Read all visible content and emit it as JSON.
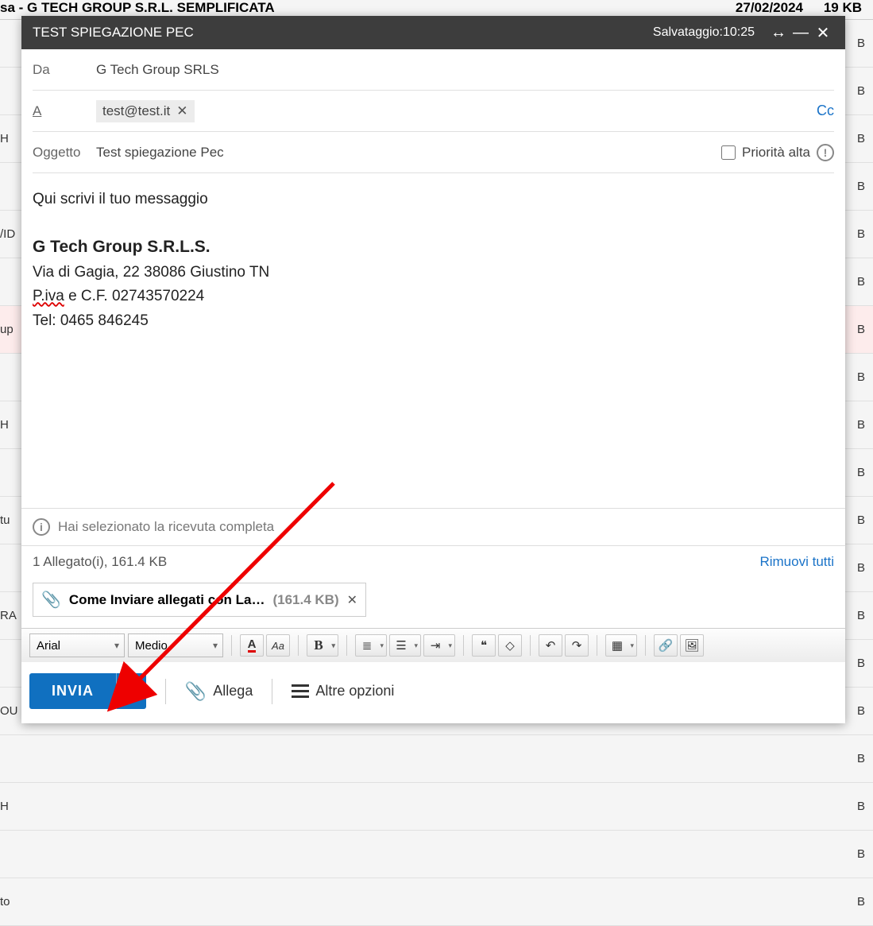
{
  "background": {
    "header_subject": "sa - G TECH GROUP S.R.L. SEMPLIFICATA",
    "header_date": "27/02/2024",
    "header_size": "19 KB",
    "rows": [
      {
        "left": ""
      },
      {
        "left": ""
      },
      {
        "left": "H"
      },
      {
        "left": ""
      },
      {
        "left": "/ID"
      },
      {
        "left": ""
      },
      {
        "left": "up",
        "pink": true
      },
      {
        "left": ""
      },
      {
        "left": "H"
      },
      {
        "left": ""
      },
      {
        "left": "tu"
      },
      {
        "left": ""
      },
      {
        "left": "RA"
      },
      {
        "left": ""
      },
      {
        "left": "OU"
      },
      {
        "left": ""
      },
      {
        "left": "H"
      },
      {
        "left": ""
      },
      {
        "left": "to"
      }
    ],
    "kb_suffix": "B"
  },
  "title": "TEST SPIEGAZIONE PEC",
  "save_label": "Salvataggio:10:25",
  "from_label": "Da",
  "from_value": "G Tech Group SRLS",
  "to_label": "A",
  "to_chip": "test@test.it",
  "cc_label": "Cc",
  "subject_label": "Oggetto",
  "subject_value": "Test spiegazione Pec",
  "priority_label": "Priorità alta",
  "body": {
    "placeholder": "Qui scrivi il tuo messaggio",
    "company": "G Tech Group S.R.L.S.",
    "address": "Via di Gagia, 22 38086 Giustino TN",
    "piva_prefix": "P.iva",
    "piva_rest": " e C.F. 02743570224",
    "tel": "Tel: 0465 846245"
  },
  "receipt_info": "Hai selezionato la ricevuta completa",
  "attachments": {
    "summary": "1 Allegato(i), 161.4 KB",
    "remove_all": "Rimuovi tutti",
    "item_name": "Come Inviare allegati con La…",
    "item_size": "(161.4 KB)"
  },
  "toolbar": {
    "font": "Arial",
    "size": "Medio"
  },
  "sendbar": {
    "send": "INVIA",
    "attach": "Allega",
    "more": "Altre opzioni"
  }
}
